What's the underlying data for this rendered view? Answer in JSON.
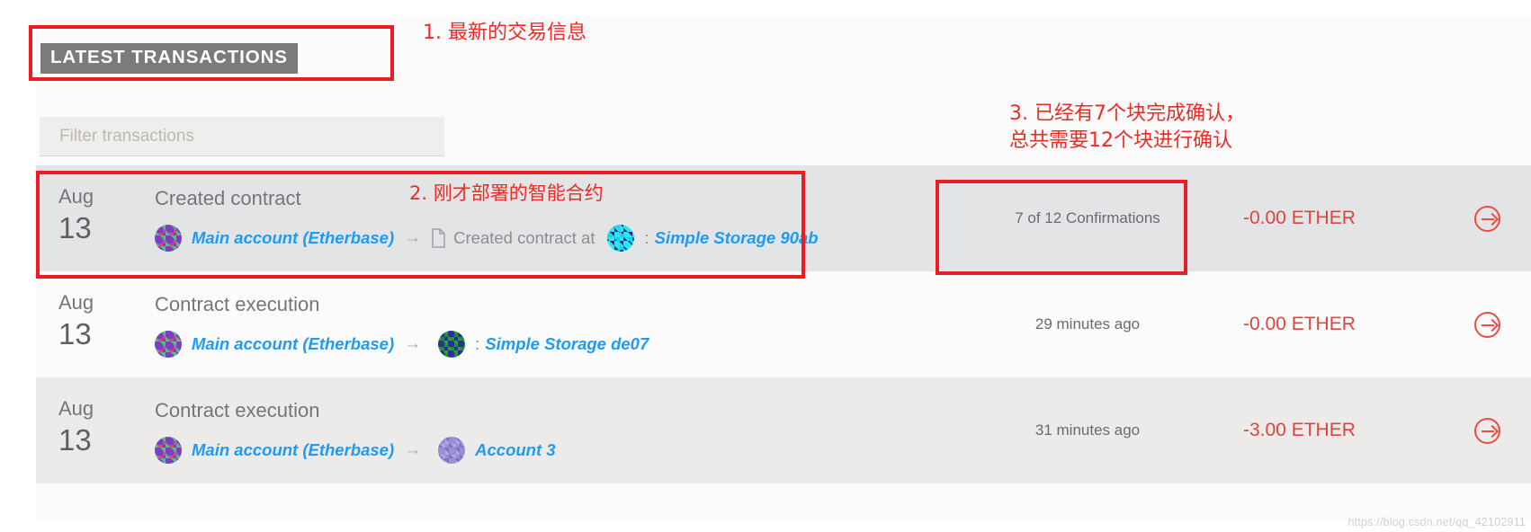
{
  "panel": {
    "title": "LATEST TRANSACTIONS",
    "title_bg": "#7c7b79"
  },
  "filter": {
    "placeholder": "Filter transactions",
    "value": ""
  },
  "colors": {
    "link": "#1d9bf7",
    "amount": "#e0443f",
    "annotation": "#ee2a26",
    "muted": "#75757a"
  },
  "transactions": [
    {
      "month": "Aug",
      "day": "13",
      "type": "Created contract",
      "from_icon": "identicon-main-account",
      "from_label": "Main account (Etherbase)",
      "arrow": "→",
      "doc_icon": "document-icon",
      "middle_text": "Created contract at",
      "to_icon": "identicon-contract-cyan",
      "to_separator": ":",
      "to_label": "Simple Storage 90ab",
      "status": "7 of 12 Confirmations",
      "amount": "-0.00 ETHER",
      "action_icon": "circle-arrow-right-icon"
    },
    {
      "month": "Aug",
      "day": "13",
      "type": "Contract execution",
      "from_icon": "identicon-main-account",
      "from_label": "Main account (Etherbase)",
      "arrow": "→",
      "doc_icon": "",
      "middle_text": "",
      "to_icon": "identicon-contract-green",
      "to_separator": ":",
      "to_label": "Simple Storage de07",
      "status": "29 minutes ago",
      "amount": "-0.00 ETHER",
      "action_icon": "circle-arrow-right-icon"
    },
    {
      "month": "Aug",
      "day": "13",
      "type": "Contract execution",
      "from_icon": "identicon-main-account",
      "from_label": "Main account (Etherbase)",
      "arrow": "→",
      "doc_icon": "",
      "middle_text": "",
      "to_icon": "identicon-account-3",
      "to_separator": "",
      "to_label": "Account 3",
      "status": "31 minutes ago",
      "amount": "-3.00 ETHER",
      "action_icon": "circle-arrow-right-icon"
    }
  ],
  "annotations": [
    {
      "id": "1",
      "text": "1. 最新的交易信息"
    },
    {
      "id": "2",
      "text": "2. 刚才部署的智能合约"
    },
    {
      "id": "3",
      "text": "3. 已经有7个块完成确认，\n总共需要12个块进行确认"
    }
  ],
  "watermark": "https://blog.csdn.net/qq_42102911"
}
